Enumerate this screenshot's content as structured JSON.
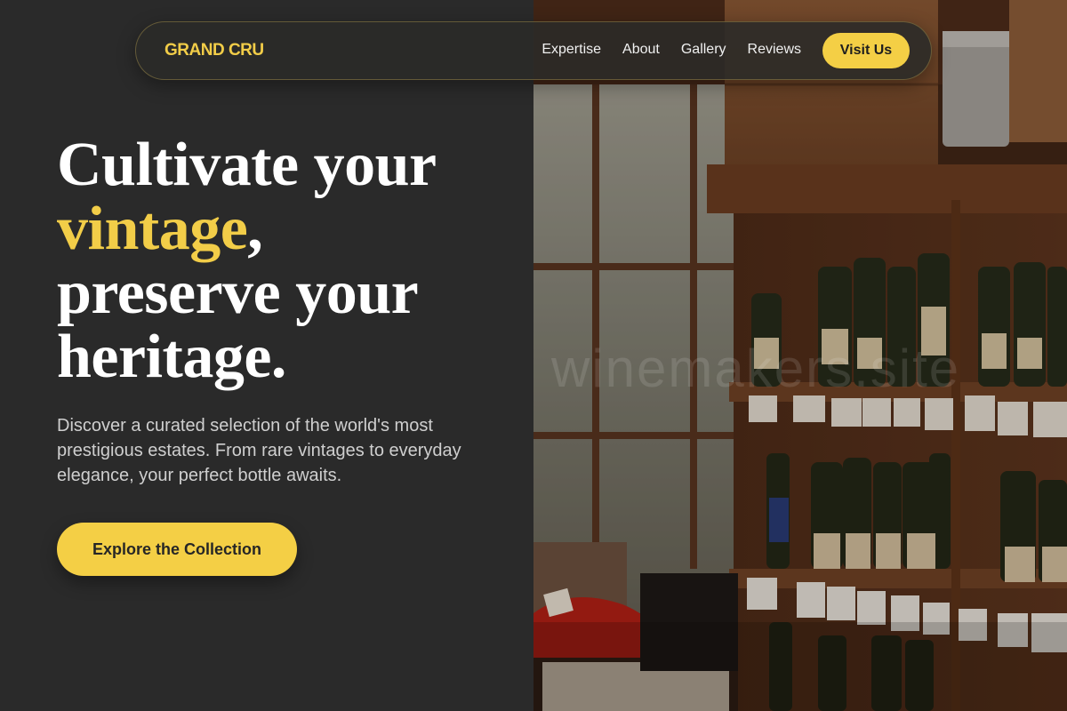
{
  "nav": {
    "logo": "GRAND CRU",
    "links": [
      "Expertise",
      "About",
      "Gallery",
      "Reviews"
    ],
    "cta": "Visit Us"
  },
  "hero": {
    "line1": "Cultivate your",
    "accent": "vintage",
    "comma": ",",
    "line3": "preserve your",
    "line4": "heritage.",
    "lead": "Discover a curated selection of the world's most prestigious estates. From rare vintages to everyday elegance, your perfect bottle awaits.",
    "cta": "Explore the Collection"
  },
  "photo": {
    "subject": "wine-shop-shelves",
    "watermark": "winemakers.site"
  },
  "colors": {
    "accent": "#f2cd48",
    "background": "#2a2a2a",
    "button": "#f4cf45"
  }
}
